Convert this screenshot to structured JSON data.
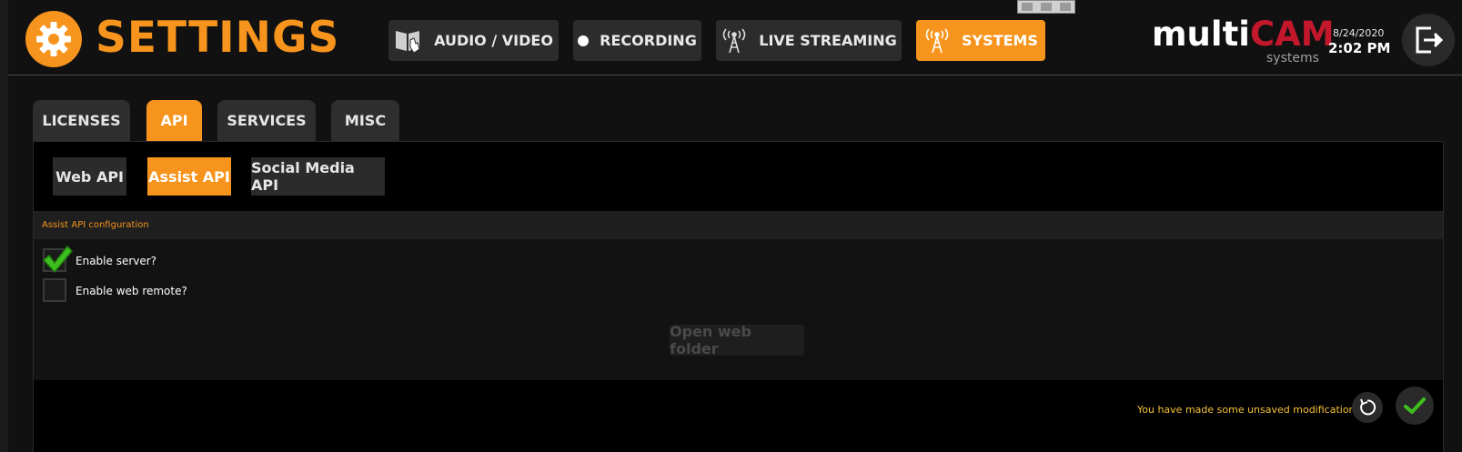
{
  "header": {
    "title": "SETTINGS",
    "nav": [
      {
        "label": "AUDIO / VIDEO",
        "icon": "book-hand-icon"
      },
      {
        "label": "RECORDING",
        "icon": "dot-icon"
      },
      {
        "label": "LIVE STREAMING",
        "icon": "antenna-icon"
      },
      {
        "label": "SYSTEMS",
        "icon": "antenna-icon",
        "active": true
      }
    ],
    "brand": {
      "multi": "multi",
      "cam": "CAM",
      "sub": "systems"
    },
    "date": "8/24/2020",
    "time": "2:02 PM"
  },
  "tabs": [
    {
      "label": "LICENSES"
    },
    {
      "label": "API",
      "active": true
    },
    {
      "label": "SERVICES"
    },
    {
      "label": "MISC"
    }
  ],
  "subtabs": [
    {
      "label": "Web API"
    },
    {
      "label": "Assist API",
      "active": true
    },
    {
      "label": "Social Media API"
    }
  ],
  "section": {
    "title": "Assist API configuration",
    "options": [
      {
        "label": "Enable server?",
        "checked": true
      },
      {
        "label": "Enable web remote?",
        "checked": false
      }
    ],
    "open_folder_label": "Open web folder"
  },
  "footer": {
    "unsaved_message": "You have made some unsaved modifications..."
  },
  "colors": {
    "accent": "#f7941d",
    "brand_red": "#c3182b",
    "check_green": "#3fbf1f",
    "warning_text": "#f7c23a"
  }
}
